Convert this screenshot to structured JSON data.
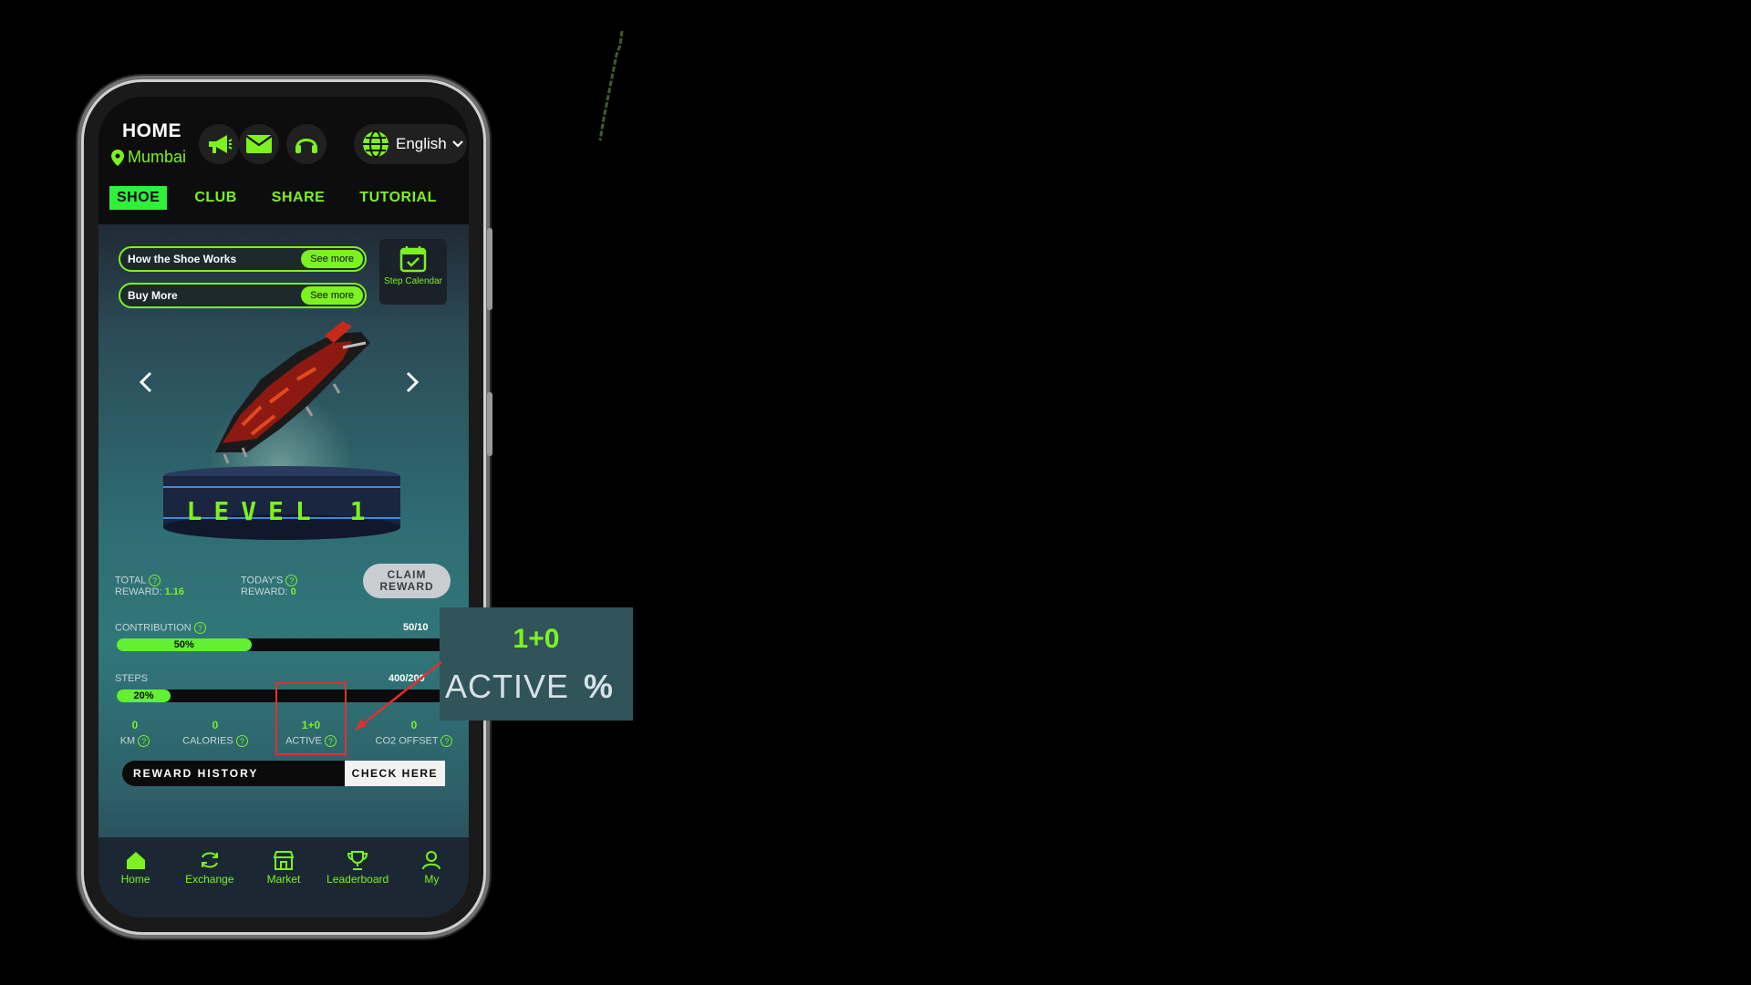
{
  "header": {
    "title": "HOME",
    "location": "Mumbai",
    "language": "English"
  },
  "tabs": [
    "SHOE",
    "CLUB",
    "SHARE",
    "TUTORIAL"
  ],
  "info_pills": [
    {
      "label": "How the Shoe Works",
      "button": "See more"
    },
    {
      "label": "Buy More",
      "button": "See more"
    }
  ],
  "calendar": {
    "label": "Step Calendar"
  },
  "shoe": {
    "level": "LEVEL 1"
  },
  "rewards": {
    "total_label_1": "TOTAL",
    "total_label_2": "REWARD:",
    "total_value": "1.16",
    "today_label_1": "TODAY'S",
    "today_label_2": "REWARD:",
    "today_value": "0",
    "claim_label": "CLAIM REWARD"
  },
  "contribution": {
    "label": "CONTRIBUTION",
    "value": "50/10",
    "percent_label": "50%",
    "percent": 50
  },
  "steps": {
    "label": "STEPS",
    "value": "400/200",
    "percent_label": "20%",
    "percent": 20
  },
  "metrics": [
    {
      "value": "0",
      "label": "KM"
    },
    {
      "value": "0",
      "label": "CALORIES"
    },
    {
      "value": "1+0",
      "label": "ACTIVE"
    },
    {
      "value": "0",
      "label": "CO2 OFFSET"
    }
  ],
  "reward_history": {
    "label": "REWARD HISTORY",
    "button": "CHECK HERE"
  },
  "nav": [
    "Home",
    "Exchange",
    "Market",
    "Leaderboard",
    "My"
  ],
  "zoom_callout": {
    "value": "1+0",
    "label": "ACTIVE",
    "suffix": "%"
  },
  "colors": {
    "accent": "#7cf221",
    "highlight": "#e0312e",
    "background": "#000000"
  }
}
